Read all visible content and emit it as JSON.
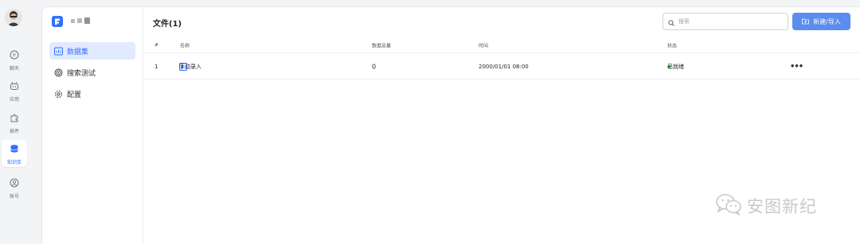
{
  "rail": {
    "items": [
      {
        "label": "聊天",
        "icon": "chat-icon"
      },
      {
        "label": "应用",
        "icon": "robot-icon"
      },
      {
        "label": "插件",
        "icon": "puzzle-icon"
      },
      {
        "label": "知识库",
        "icon": "database-icon",
        "active": true
      },
      {
        "label": "账号",
        "icon": "user-icon"
      }
    ]
  },
  "subnav": {
    "items": [
      {
        "label": "数据集",
        "icon": "dataset-icon",
        "active": true
      },
      {
        "label": "搜索测试",
        "icon": "target-icon"
      },
      {
        "label": "配置",
        "icon": "gear-icon"
      }
    ]
  },
  "main": {
    "title": "文件(1)",
    "search_placeholder": "搜索",
    "new_button": "新建/导入",
    "columns": [
      "#",
      "名称",
      "数据总量",
      "时间",
      "状态"
    ],
    "rows": [
      {
        "index": "1",
        "name": "手动录入",
        "count": "0",
        "time": "2000/01/01 08:00",
        "status": "已就绪"
      }
    ]
  },
  "watermark": "安图新纪",
  "colors": {
    "accent": "#3370ff",
    "button": "#5b8def",
    "ready": "#34c759"
  }
}
